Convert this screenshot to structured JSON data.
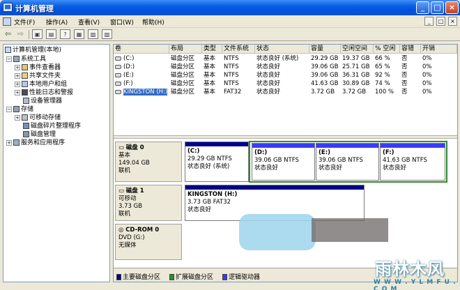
{
  "window": {
    "title": "计算机管理",
    "buttons": {
      "minimize": "_",
      "maximize": "□",
      "close": "×"
    }
  },
  "menu": {
    "items": [
      "文件(F)",
      "操作(A)",
      "查看(V)",
      "窗口(W)",
      "帮助(H)"
    ],
    "mdi_buttons": [
      "_",
      "□",
      "×"
    ]
  },
  "toolbar": {
    "icons": [
      "back-arrow-icon",
      "forward-arrow-icon",
      "up-folder-icon",
      "show-hide-tree-icon",
      "help-icon",
      "properties-icon",
      "export-icon",
      "refresh-icon"
    ],
    "glyphs": [
      "⇦",
      "⇨"
    ]
  },
  "tree": {
    "items": [
      {
        "label": "计算机管理(本地)",
        "icon": "computer-icon",
        "expander": ""
      },
      {
        "label": "系统工具",
        "icon": "tools-icon",
        "expander": "−"
      },
      {
        "label": "事件查看器",
        "icon": "event-viewer-icon",
        "expander": "+"
      },
      {
        "label": "共享文件夹",
        "icon": "shared-folder-icon",
        "expander": "+"
      },
      {
        "label": "本地用户和组",
        "icon": "users-icon",
        "expander": "+"
      },
      {
        "label": "性能日志和警报",
        "icon": "performance-icon",
        "expander": "+"
      },
      {
        "label": "设备管理器",
        "icon": "device-manager-icon",
        "expander": ""
      },
      {
        "label": "存储",
        "icon": "storage-icon",
        "expander": "−"
      },
      {
        "label": "可移动存储",
        "icon": "removable-storage-icon",
        "expander": "+"
      },
      {
        "label": "磁盘碎片整理程序",
        "icon": "defrag-icon",
        "expander": ""
      },
      {
        "label": "磁盘管理",
        "icon": "disk-management-icon",
        "expander": ""
      },
      {
        "label": "服务和应用程序",
        "icon": "services-icon",
        "expander": "+"
      }
    ]
  },
  "volumes": {
    "headers": [
      "卷",
      "布局",
      "类型",
      "文件系统",
      "状态",
      "容量",
      "空闲空间",
      "% 空闲",
      "容错",
      "开销"
    ],
    "rows": [
      [
        "(C:)",
        "磁盘分区",
        "基本",
        "NTFS",
        "状态良好 (系统)",
        "29.29 GB",
        "19.37 GB",
        "66 %",
        "否",
        "0%"
      ],
      [
        "(D:)",
        "磁盘分区",
        "基本",
        "NTFS",
        "状态良好",
        "39.06 GB",
        "25.71 GB",
        "65 %",
        "否",
        "0%"
      ],
      [
        "(E:)",
        "磁盘分区",
        "基本",
        "NTFS",
        "状态良好",
        "39.06 GB",
        "36.31 GB",
        "92 %",
        "否",
        "0%"
      ],
      [
        "(F:)",
        "磁盘分区",
        "基本",
        "NTFS",
        "状态良好",
        "41.63 GB",
        "30.89 GB",
        "74 %",
        "否",
        "0%"
      ],
      [
        "KINGSTON (H:)",
        "磁盘分区",
        "基本",
        "FAT32",
        "状态良好",
        "3.72 GB",
        "3.72 GB",
        "100 %",
        "否",
        "0%"
      ]
    ]
  },
  "disks": [
    {
      "name": "磁盘 0",
      "lines": [
        "基本",
        "149.04 GB",
        "联机"
      ],
      "partitions": [
        {
          "name": "(C:)",
          "size": "29.29 GB NTFS",
          "status": "状态良好 (系统)"
        },
        {
          "name": "(D:)",
          "size": "39.06 GB NTFS",
          "status": "状态良好"
        },
        {
          "name": "(E:)",
          "size": "39.06 GB NTFS",
          "status": "状态良好"
        },
        {
          "name": "(F:)",
          "size": "41.63 GB NTFS",
          "status": "状态良好"
        }
      ]
    },
    {
      "name": "磁盘 1",
      "lines": [
        "可移动",
        "3.73 GB",
        "联机"
      ],
      "partitions": [
        {
          "name": "KINGSTON  (H:)",
          "size": "3.73 GB FAT32",
          "status": "状态良好"
        }
      ]
    },
    {
      "name": "CD-ROM 0",
      "lines": [
        "DVD (G:)",
        "",
        "无媒体"
      ],
      "partitions": []
    }
  ],
  "legend": [
    {
      "label": "主要磁盘分区",
      "color": "#00008b"
    },
    {
      "label": "扩展磁盘分区",
      "color": "#2e8b2e"
    },
    {
      "label": "逻辑驱动器",
      "color": "#3a3aff"
    }
  ],
  "watermark": {
    "big": "雨林木风",
    "small": "W W W . Y L M F U . C O M"
  }
}
